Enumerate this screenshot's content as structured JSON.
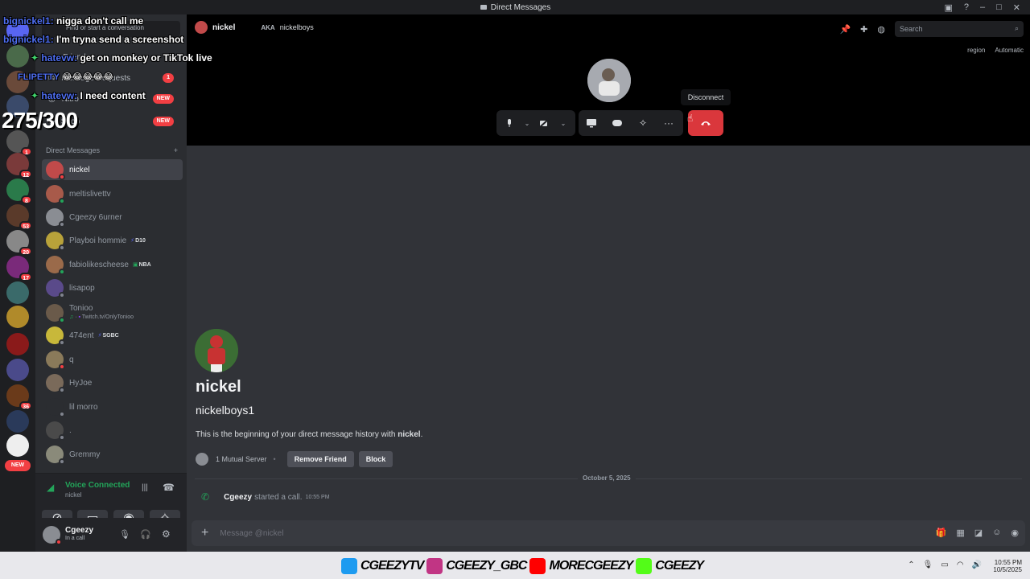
{
  "window": {
    "title": "Direct Messages"
  },
  "sidebar": {
    "find_placeholder": "Find or start a conversation",
    "nav": [
      {
        "label": "Friends"
      },
      {
        "label": "Message Requests",
        "badge": "1"
      },
      {
        "label": "Nitro",
        "badge": "NEW"
      },
      {
        "label": "Shop",
        "badge": "NEW"
      }
    ],
    "dm_header": "Direct Messages",
    "dms": [
      {
        "name": "nickel"
      },
      {
        "name": "meltislivettv"
      },
      {
        "name": "Cgeezy 6urner"
      },
      {
        "name": "Playboi hommie",
        "tag": "D10"
      },
      {
        "name": "fabiolikescheese",
        "tag": "NBA"
      },
      {
        "name": "lisapop"
      },
      {
        "name": "Tonioo",
        "sub": "Twitch.tv/OnlyTonioo"
      },
      {
        "name": "474ent",
        "tag": "SGBC"
      },
      {
        "name": "q"
      },
      {
        "name": "HyJoe"
      },
      {
        "name": "lil morro"
      },
      {
        "name": "."
      },
      {
        "name": "Gremmy"
      }
    ]
  },
  "guild_badges": [
    "1",
    "12",
    "8",
    "53",
    "20",
    "17",
    "36"
  ],
  "guild_new": "NEW",
  "voice": {
    "title": "Voice Connected",
    "channel": "nickel"
  },
  "user": {
    "name": "Cgeezy",
    "status": "In a call"
  },
  "header": {
    "name": "nickel",
    "aka_label": "AKA",
    "aka_value": "nickelboys",
    "search_placeholder": "Search"
  },
  "call": {
    "region_label": "region",
    "region_value": "Automatic",
    "tooltip": "Disconnect"
  },
  "profile": {
    "display_name": "nickel",
    "username": "nickelboys1",
    "intro_prefix": "This is the beginning of your direct message history with ",
    "intro_name": "nickel",
    "intro_suffix": ".",
    "mutual": "1 Mutual Server",
    "remove_friend": "Remove Friend",
    "block": "Block"
  },
  "messages": {
    "date_divider": "October 5, 2025",
    "call_user": "Cgeezy",
    "call_text": "started a call.",
    "call_time": "10:55 PM"
  },
  "composer": {
    "placeholder": "Message @nickel"
  },
  "stream_overlay": {
    "chat": [
      {
        "user": "bignickel1:",
        "text": "nigga don't call me"
      },
      {
        "user": "bignickel1:",
        "text": "I'm tryna send a screenshot"
      },
      {
        "user": "hatevw:",
        "text": "get on monkey or TikTok live"
      },
      {
        "user": "FLIPETTY",
        "text": "😂😂😂😂😂"
      },
      {
        "user": "hatevw:",
        "text": "I need content"
      }
    ],
    "counter": "275/300"
  },
  "taskbar": {
    "socials": [
      "CGEEZYTV",
      "CGEEZY_GBC",
      "MORECGEEZY",
      "CGEEZY"
    ],
    "time": "10:55 PM",
    "date": "10/5/2025"
  },
  "colors": {
    "accent": "#5865f2",
    "danger": "#da373c",
    "online": "#23a55a"
  }
}
